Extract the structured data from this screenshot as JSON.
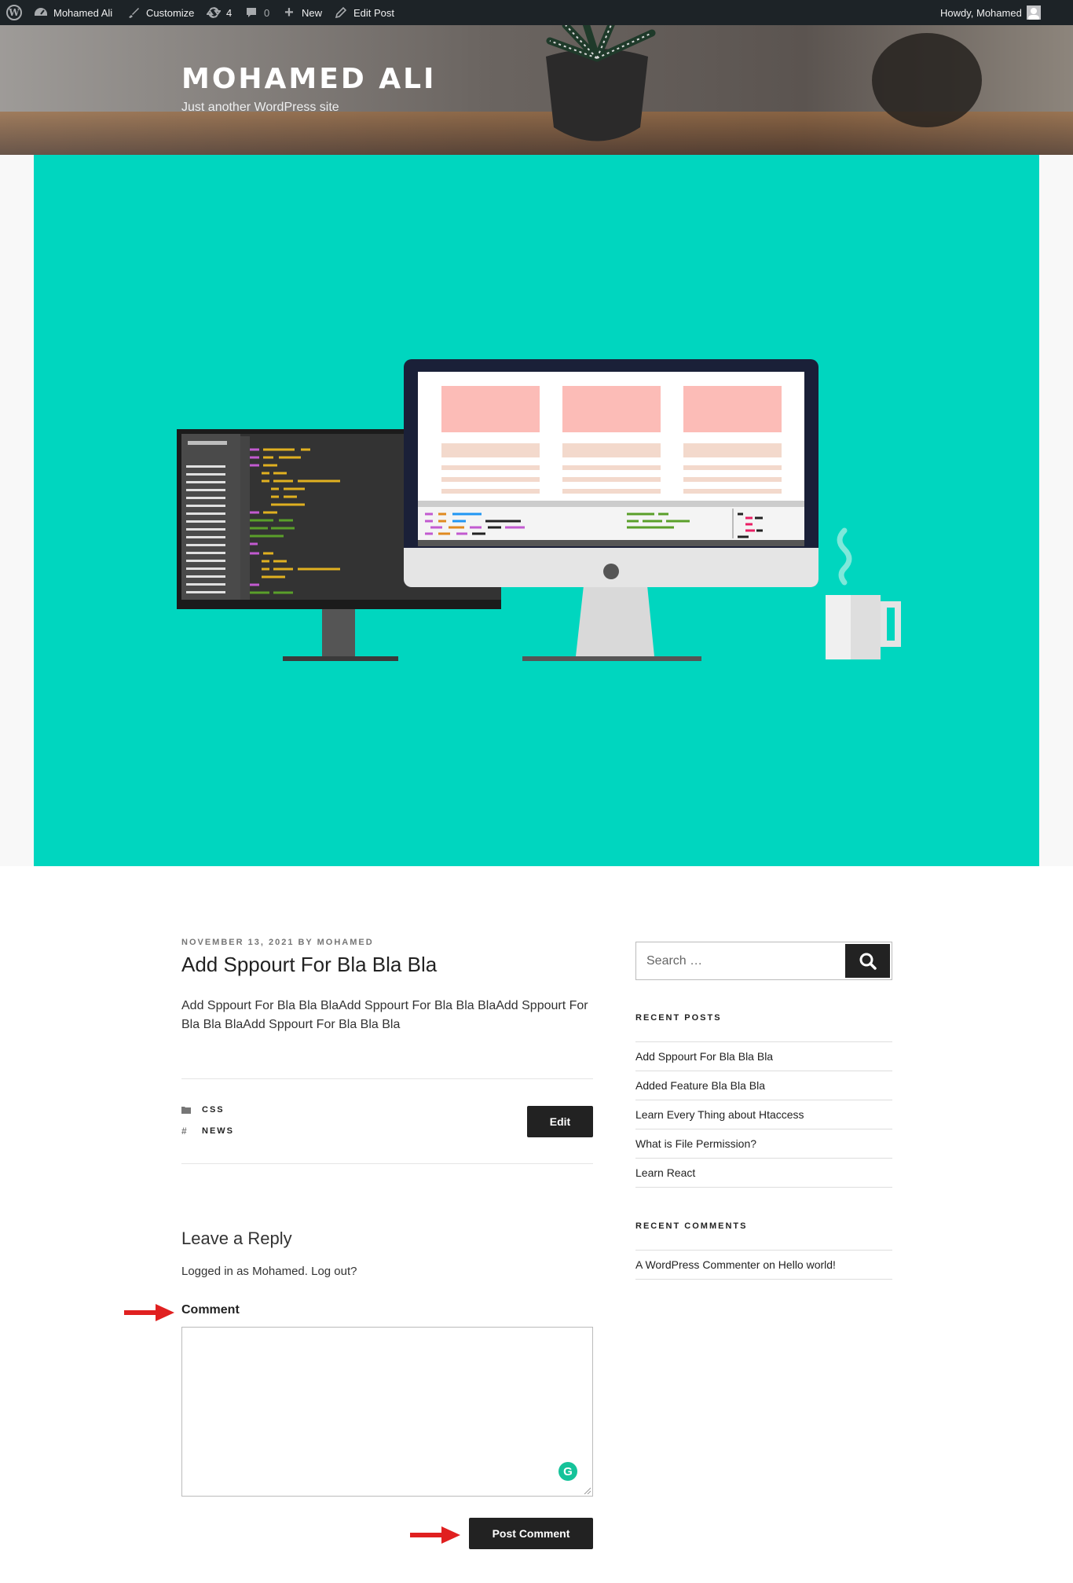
{
  "admin_bar": {
    "site_name": "Mohamed Ali",
    "customize": "Customize",
    "updates_count": "4",
    "comments_count": "0",
    "new": "New",
    "edit_post": "Edit Post",
    "howdy": "Howdy, Mohamed"
  },
  "header": {
    "site_title": "MOHAMED ALI",
    "tagline": "Just another WordPress site"
  },
  "post": {
    "meta": "NOVEMBER 13, 2021 BY MOHAMED",
    "title": "Add Sppourt For Bla Bla Bla",
    "content": "Add Sppourt For Bla Bla BlaAdd Sppourt For Bla Bla BlaAdd Sppourt For Bla Bla BlaAdd Sppourt For Bla Bla Bla",
    "category": "CSS",
    "tag": "NEWS",
    "edit_label": "Edit"
  },
  "reply": {
    "title": "Leave a Reply",
    "logged_in": "Logged in as Mohamed. Log out?",
    "comment_label": "Comment",
    "submit_label": "Post Comment"
  },
  "sidebar": {
    "search_placeholder": "Search …",
    "recent_posts_title": "RECENT POSTS",
    "recent_posts": [
      "Add Sppourt For Bla Bla Bla",
      "Added Feature Bla Bla Bla",
      "Learn Every Thing about Htaccess",
      "What is File Permission?",
      "Learn React"
    ],
    "recent_comments_title": "RECENT COMMENTS",
    "recent_comments": [
      "A WordPress Commenter on Hello world!"
    ]
  },
  "colors": {
    "admin_bar": "#1d2327",
    "featured_bg": "#00d6bf",
    "button_dark": "#222222",
    "annotation_arrow": "#e02020"
  }
}
